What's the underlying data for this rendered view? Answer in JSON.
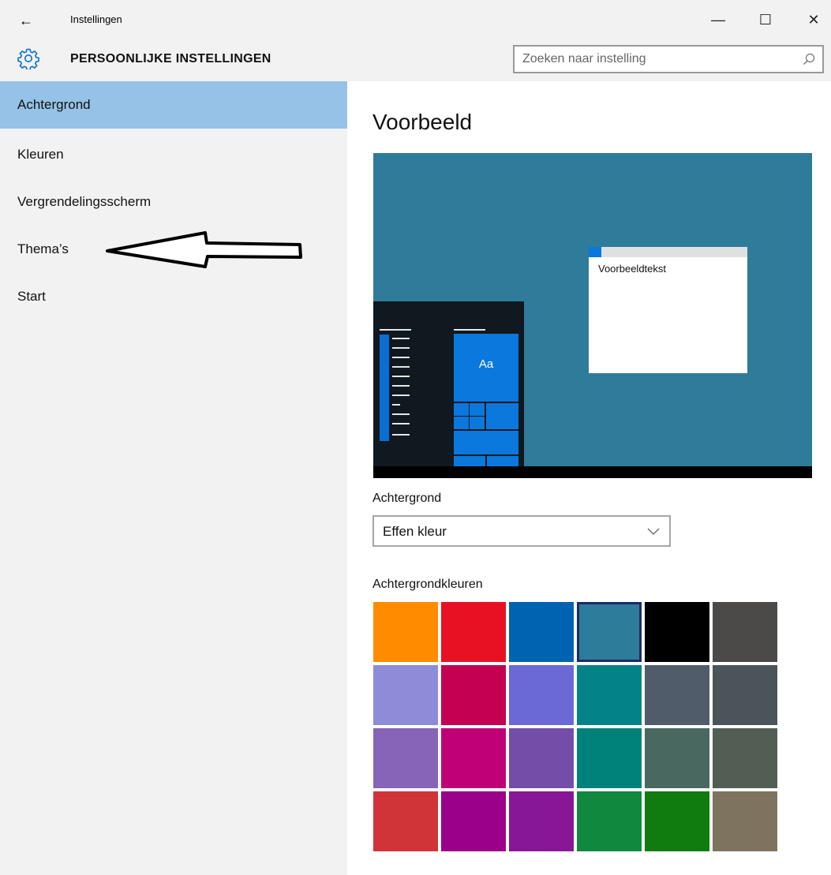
{
  "window": {
    "title": "Instellingen",
    "back_icon": "←",
    "minimize_icon": "—",
    "maximize_icon": "☐",
    "close_icon": "✕"
  },
  "header": {
    "title": "PERSOONLIJKE INSTELLINGEN",
    "icon": "gear-icon",
    "search_placeholder": "Zoeken naar instelling"
  },
  "sidebar": {
    "items": [
      {
        "label": "Achtergrond",
        "active": true
      },
      {
        "label": "Kleuren",
        "active": false
      },
      {
        "label": "Vergrendelingsscherm",
        "active": false
      },
      {
        "label": "Thema’s",
        "active": false
      },
      {
        "label": "Start",
        "active": false
      }
    ]
  },
  "main": {
    "preview_title": "Voorbeeld",
    "preview": {
      "tile_label": "Aa",
      "sample_text": "Voorbeeldtekst",
      "background_color": "#2f7b9a",
      "accent_color": "#0a78dc"
    },
    "background": {
      "label": "Achtergrond",
      "selected": "Effen kleur"
    },
    "colors": {
      "label": "Achtergrondkleuren",
      "selected_index": 3,
      "swatches": [
        "#ff8c00",
        "#e81123",
        "#0063b1",
        "#2d7d9a",
        "#000000",
        "#4c4a48",
        "#8e8cd8",
        "#c30052",
        "#6b69d6",
        "#038387",
        "#515c6b",
        "#4a5459",
        "#8764b8",
        "#bf0077",
        "#744da9",
        "#00827a",
        "#486860",
        "#525e54",
        "#d13438",
        "#9a0089",
        "#881798",
        "#10893e",
        "#107c10",
        "#7e735f"
      ]
    }
  }
}
